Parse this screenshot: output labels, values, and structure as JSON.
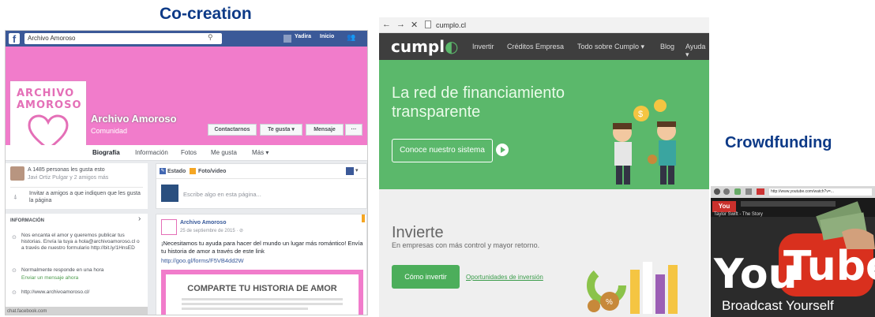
{
  "headings": {
    "left": "Co-creation",
    "right": "Crowdfunding"
  },
  "facebook": {
    "search_value": "Archivo Amoroso",
    "top_user": "Yadira",
    "top_home": "Inicio",
    "logo_line1": "ARCHIVO",
    "logo_line2": "AMOROSO",
    "page_name": "Archivo Amoroso",
    "page_category": "Comunidad",
    "buttons": {
      "contact": "Contactarnos",
      "like": "Te gusta ▾",
      "message": "Mensaje",
      "more": "···"
    },
    "tabs": [
      "Biografía",
      "Información",
      "Fotos",
      "Me gusta",
      "Más ▾"
    ],
    "likes_count_text": "A 1485 personas les gusta esto",
    "likes_friends_text": "Javi Ortiz Pulgar y 2 amigos más",
    "invite_text": "Invitar a amigos a que indiquen que les gusta la página",
    "info_header": "INFORMACIÓN",
    "info_about": "Nos encanta el amor y queremos publicar tus historias. Envía la tuya a hola@archivoamoroso.cl o a través de nuestro formulario http://bit.ly/1HnsED",
    "info_response": "Normalmente responde en una hora",
    "info_send_message": "Enviar un mensaje ahora",
    "info_website": "http://www.archivoamoroso.cl/",
    "composer_status": "Estado",
    "composer_photo": "Foto/video",
    "composer_placeholder": "Escribe algo en esta página...",
    "post_author": "Archivo Amoroso",
    "post_date": "25 de septiembre de 2015 · ⊘",
    "post_text": "¡Necesitamos tu ayuda para hacer del mundo un lugar más romántico! Envía tu historia de amor a través de este link",
    "post_link": "http://goo.gl/forms/F5VB4dd2W",
    "share_title": "COMPARTE TU HISTORIA DE AMOR",
    "status_bar": "chat.facebook.com"
  },
  "cumplo": {
    "nav_back": "←",
    "nav_forward": "→",
    "nav_close": "✕",
    "url": "cumplo.cl",
    "brand": "cumpl",
    "menu": [
      "Invertir",
      "Créditos Empresa",
      "Todo sobre Cumplo ▾",
      "Blog",
      "Ayuda ▾"
    ],
    "hero_title": "La red de financiamiento transparente",
    "hero_cta": "Conoce nuestro sistema",
    "section_title": "Invierte",
    "section_subtitle": "En empresas con más control y mayor retorno.",
    "invest_button": "Cómo invertir",
    "invest_link": "Oportunidades de inversión"
  },
  "youtube": {
    "address": "http://www.youtube.com/watch?v=...",
    "channel_line": "Taylor Swift - The Story",
    "big_you": "You",
    "big_tube": "Tube",
    "tagline": "Broadcast Yourself"
  }
}
